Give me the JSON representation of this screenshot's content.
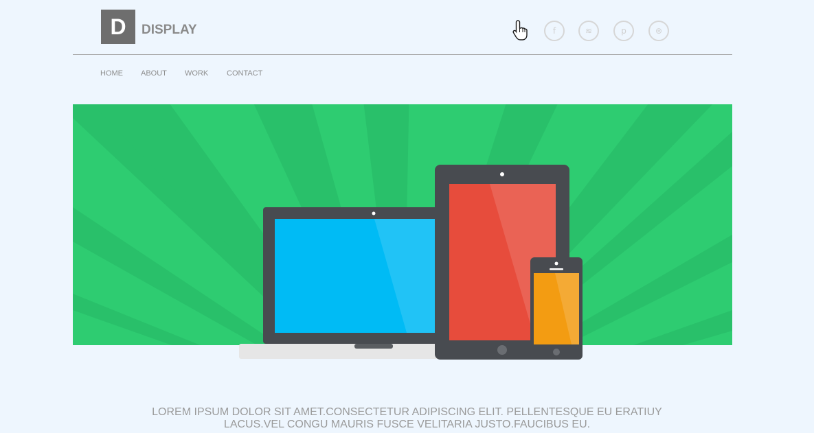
{
  "brand": {
    "logo_letter": "D",
    "name": "DISPLAY"
  },
  "social": [
    {
      "icon": "facebook-icon",
      "glyph": "f"
    },
    {
      "icon": "rss-icon",
      "glyph": "≋"
    },
    {
      "icon": "pinterest-icon",
      "glyph": "p"
    },
    {
      "icon": "dribbble-icon",
      "glyph": "⊛"
    }
  ],
  "nav": {
    "items": [
      "HOME",
      "ABOUT",
      "WORK",
      "CONTACT"
    ]
  },
  "hero": {
    "background": "#2ecc71",
    "ray_color": "#29c06a",
    "laptop_screen": "#00bbf5",
    "tablet_screen": "#e74c3c",
    "phone_screen": "#f39c12",
    "device_frame": "#484b50"
  },
  "tagline": {
    "line1": "LOREM IPSUM DOLOR SIT AMET.CONSECTETUR ADIPISCING ELIT. PELLENTESQUE EU ERATIUY",
    "line2": "LACUS.VEL CONGU MAURIS FUSCE VELITARIA JUSTO.FAUCIBUS EU."
  }
}
